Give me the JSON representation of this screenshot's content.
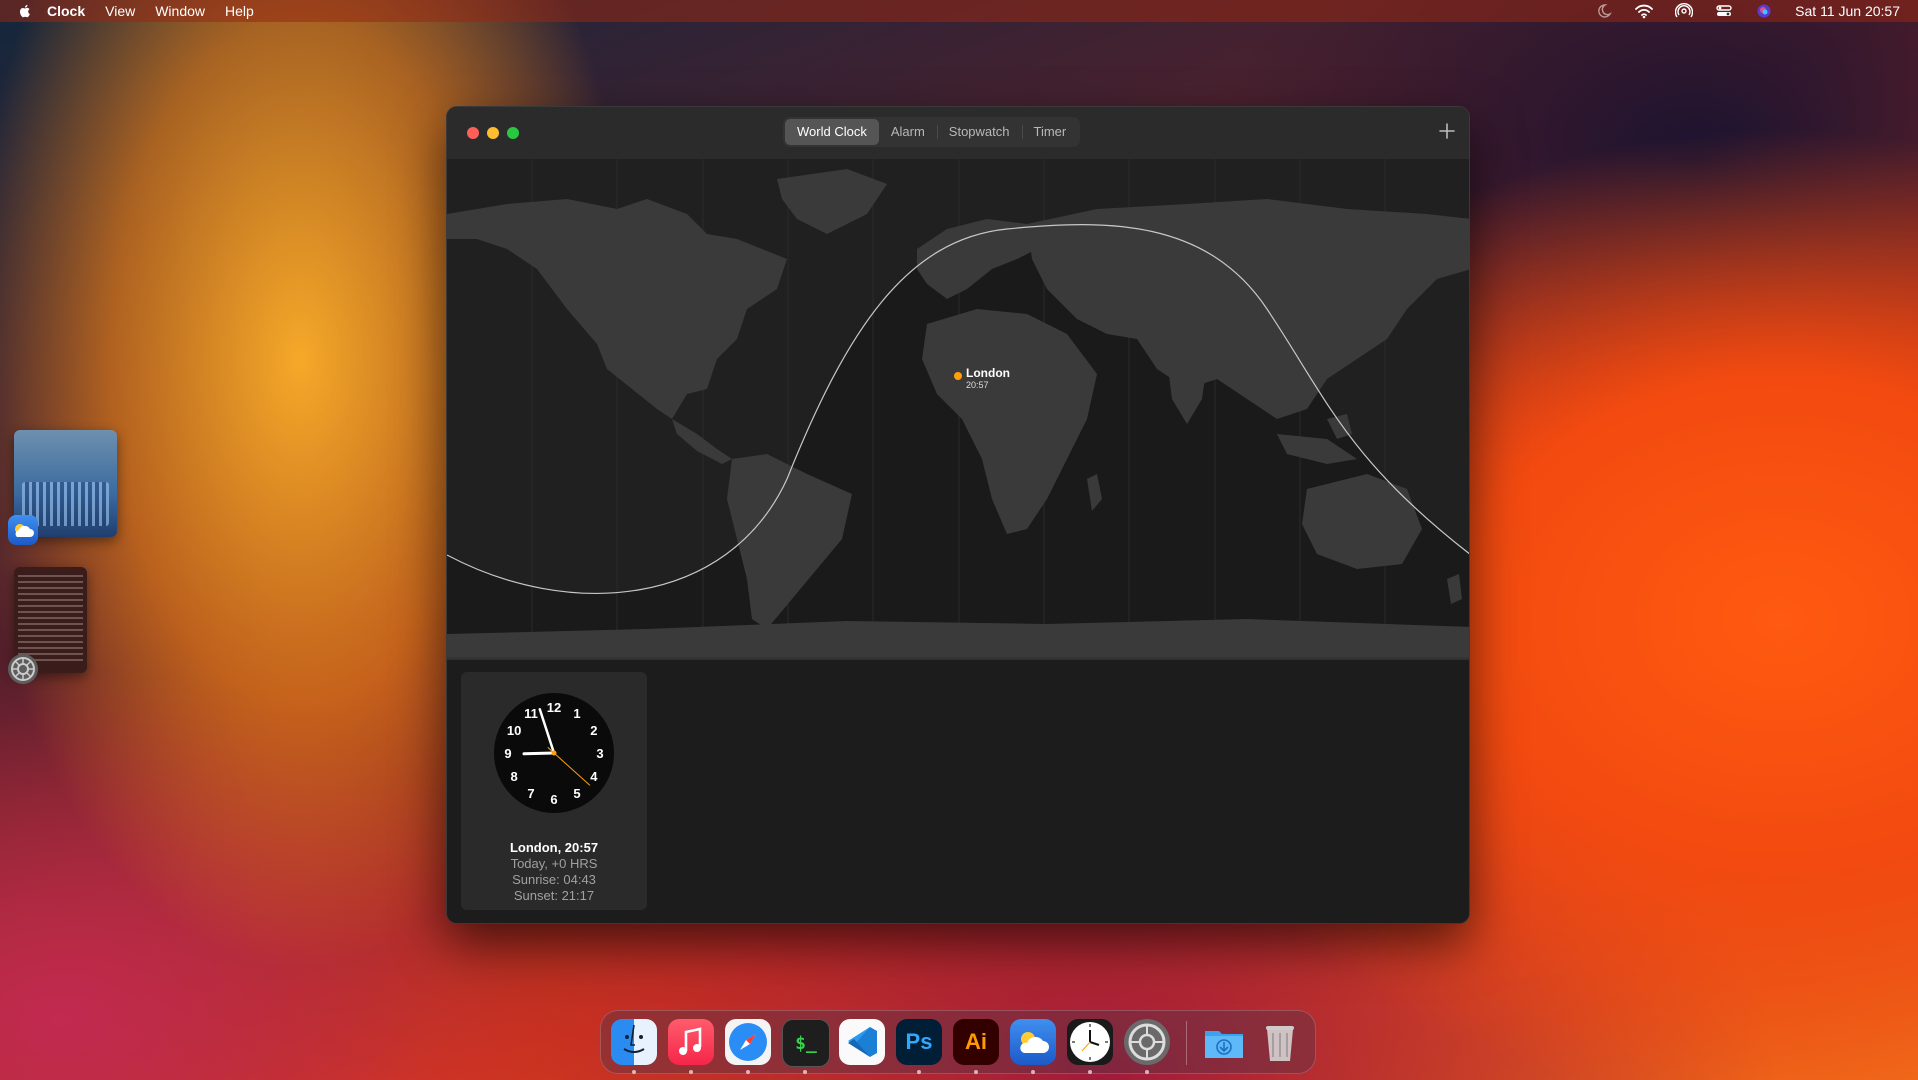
{
  "menubar": {
    "app_name": "Clock",
    "menus": [
      "View",
      "Window",
      "Help"
    ],
    "datetime": "Sat 11 Jun  20:57"
  },
  "window": {
    "tabs": [
      "World Clock",
      "Alarm",
      "Stopwatch",
      "Timer"
    ],
    "active_tab": "World Clock"
  },
  "map": {
    "city": {
      "name": "London",
      "time": "20:57"
    }
  },
  "clock_card": {
    "title": "London, 20:57",
    "day_offset": "Today, +0 HRS",
    "sunrise": "Sunrise: 04:43",
    "sunset": "Sunset: 21:17",
    "face_numbers": [
      "12",
      "1",
      "2",
      "3",
      "4",
      "5",
      "6",
      "7",
      "8",
      "9",
      "10",
      "11"
    ],
    "time": {
      "hours": 20,
      "minutes": 57,
      "seconds": 22
    }
  },
  "dock": {
    "apps": [
      "finder-icon",
      "music-icon",
      "safari-icon",
      "terminal-icon",
      "vscode-icon",
      "photoshop-icon",
      "illustrator-icon",
      "weather-icon",
      "clock-icon",
      "system-settings-icon",
      "downloads-folder-icon",
      "trash-icon"
    ],
    "photoshop_label": "Ps",
    "illustrator_label": "Ai",
    "terminal_label": "$_"
  },
  "colors": {
    "accent_orange": "#ff9f0a",
    "window_bg": "#1e1e1e",
    "map_land": "#3a3a3a"
  }
}
